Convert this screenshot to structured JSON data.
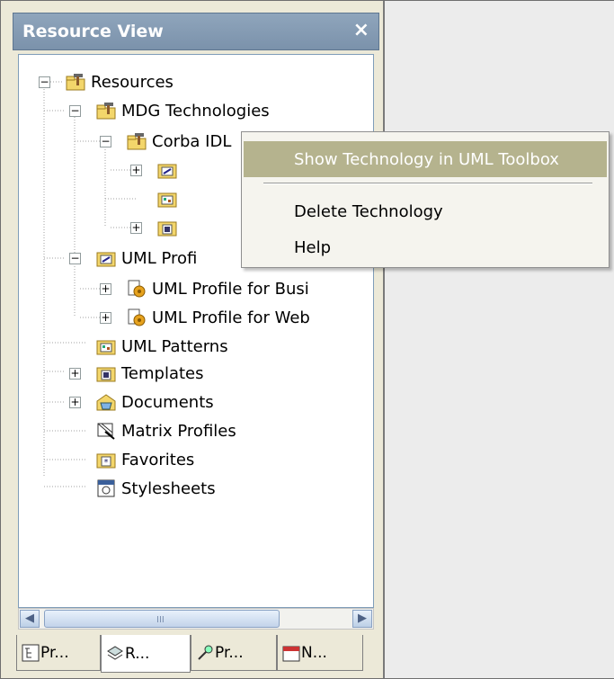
{
  "panel": {
    "title": "Resource View",
    "close_glyph": "×",
    "tree": [
      {
        "label": "Resources",
        "icon": "hammer-folder-icon"
      },
      {
        "label": "MDG Technologies",
        "icon": "hammer-folder-icon"
      },
      {
        "label": "Corba IDL",
        "icon": "hammer-folder-icon"
      },
      {
        "label": "",
        "icon": "toolbox-folder-icon"
      },
      {
        "label": "",
        "icon": "pattern-folder-icon"
      },
      {
        "label": "",
        "icon": "template-folder-icon"
      },
      {
        "label": "UML Profi",
        "icon": "toolbox-folder-icon"
      },
      {
        "label": "UML Profile for Busi",
        "icon": "profile-icon"
      },
      {
        "label": "UML Profile for Web",
        "icon": "profile-icon"
      },
      {
        "label": "UML Patterns",
        "icon": "pattern-folder-icon"
      },
      {
        "label": "Templates",
        "icon": "template-folder-icon"
      },
      {
        "label": "Documents",
        "icon": "documents-icon"
      },
      {
        "label": "Matrix Profiles",
        "icon": "matrix-icon"
      },
      {
        "label": "Favorites",
        "icon": "favorites-icon"
      },
      {
        "label": "Stylesheets",
        "icon": "stylesheet-icon"
      }
    ],
    "scroll_grip": "III",
    "tabs": [
      {
        "label": "Pr...",
        "icon": "project-browser-icon"
      },
      {
        "label": "R...",
        "icon": "resources-icon"
      },
      {
        "label": "Pr...",
        "icon": "properties-icon"
      },
      {
        "label": "N...",
        "icon": "notes-icon"
      }
    ]
  },
  "context_menu": {
    "items": [
      {
        "label": "Show Technology in UML Toolbox"
      },
      {
        "label": "Delete Technology"
      },
      {
        "label": "Help"
      }
    ]
  },
  "colors": {
    "title_bar": "#7b92ab",
    "menu_highlight": "#b5b38e"
  }
}
